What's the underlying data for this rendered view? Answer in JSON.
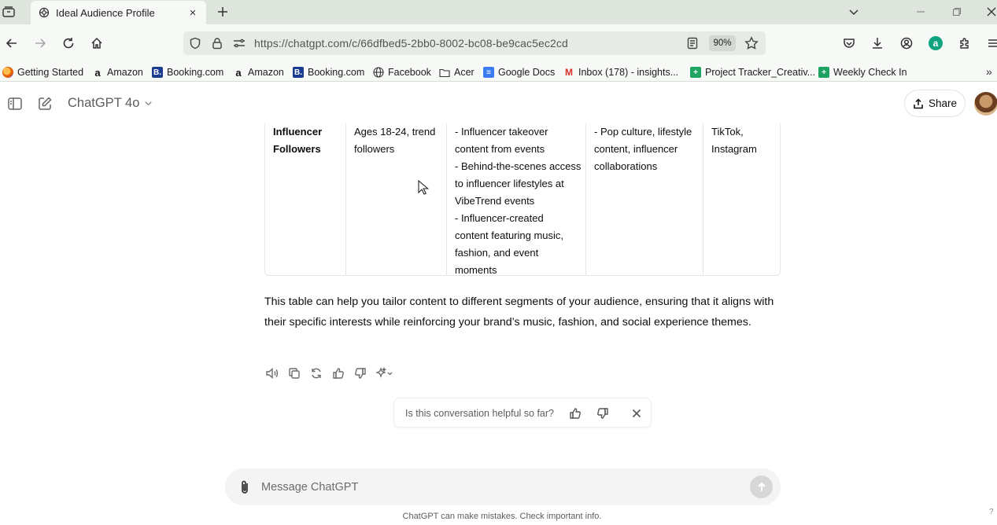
{
  "browser": {
    "tab": {
      "title": "Ideal Audience Profile",
      "close": "×"
    },
    "address": {
      "url": "https://chatgpt.com/c/66dfbed5-2bb0-8002-bc08-be9cac5ec2cd",
      "zoom": "90%"
    },
    "bookmarks": [
      {
        "label": "Getting Started",
        "icon": "firefox-icon"
      },
      {
        "label": "Amazon",
        "icon": "amazon-icon"
      },
      {
        "label": "Booking.com",
        "icon": "booking-icon"
      },
      {
        "label": "Amazon",
        "icon": "amazon-icon"
      },
      {
        "label": "Booking.com",
        "icon": "booking-icon"
      },
      {
        "label": "Facebook",
        "icon": "globe-icon"
      },
      {
        "label": "Acer",
        "icon": "folder-icon"
      },
      {
        "label": "Google Docs",
        "icon": "google-docs-icon"
      },
      {
        "label": "Inbox (178) - insights...",
        "icon": "gmail-icon"
      },
      {
        "label": "Project Tracker_Creativ...",
        "icon": "sheets-icon"
      },
      {
        "label": "Weekly Check In",
        "icon": "sheets-icon"
      }
    ]
  },
  "app": {
    "model": "ChatGPT 4o",
    "share_label": "Share"
  },
  "table": {
    "columns": [
      {
        "lines": [
          "Influencer",
          "Followers"
        ],
        "bold": true
      },
      {
        "lines": [
          "Ages 18-24, trend",
          "followers"
        ],
        "bold": false
      },
      {
        "lines": [
          "- Influencer takeover",
          "content from events",
          "- Behind-the-scenes access",
          "to influencer lifestyles at",
          "VibeTrend events",
          "- Influencer-created",
          "content featuring music,",
          "fashion, and event",
          "moments"
        ],
        "bold": false
      },
      {
        "lines": [
          "- Pop culture, lifestyle",
          "content, influencer",
          "collaborations"
        ],
        "bold": false
      },
      {
        "lines": [
          "TikTok,",
          "Instagram"
        ],
        "bold": false
      }
    ]
  },
  "message": {
    "text": "This table can help you tailor content to different segments of your audience, ensuring that it aligns with their specific interests while reinforcing your brand’s music, fashion, and social experience themes."
  },
  "feedback": {
    "question": "Is this conversation helpful so far?"
  },
  "composer": {
    "placeholder": "Message ChatGPT"
  },
  "footer": {
    "disclaimer": "ChatGPT can make mistakes. Check important info.",
    "help": "?"
  },
  "colors": {
    "tabstrip": "#dde5dc",
    "toolbar": "#f7f9f6",
    "accent": "#10a37f"
  }
}
